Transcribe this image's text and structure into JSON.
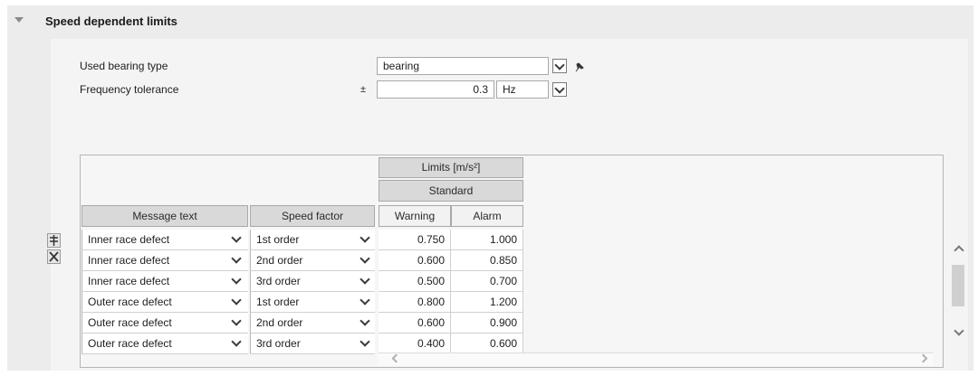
{
  "section": {
    "title": "Speed dependent limits"
  },
  "form": {
    "bearing_type_label": "Used bearing type",
    "bearing_type_value": "bearing",
    "tolerance_label": "Frequency tolerance",
    "tolerance_prefix": "±",
    "tolerance_value": "0.3",
    "tolerance_unit": "Hz"
  },
  "table": {
    "group_header": "Limits [m/s²]",
    "subgroup_header": "Standard",
    "columns": [
      "Message text",
      "Speed factor",
      "Warning",
      "Alarm"
    ],
    "rows": [
      {
        "message": "Inner race defect",
        "factor": "1st order",
        "warning": "0.750",
        "alarm": "1.000"
      },
      {
        "message": "Inner race defect",
        "factor": "2nd order",
        "warning": "0.600",
        "alarm": "0.850"
      },
      {
        "message": "Inner race defect",
        "factor": "3rd order",
        "warning": "0.500",
        "alarm": "0.700"
      },
      {
        "message": "Outer race defect",
        "factor": "1st order",
        "warning": "0.800",
        "alarm": "1.200"
      },
      {
        "message": "Outer race defect",
        "factor": "2nd order",
        "warning": "0.600",
        "alarm": "0.900"
      },
      {
        "message": "Outer race defect",
        "factor": "3rd order",
        "warning": "0.400",
        "alarm": "0.600"
      }
    ]
  },
  "icons": {
    "collapse": "triangle-down-icon",
    "pin": "pin-icon",
    "add_row": "add-row-icon",
    "delete_row": "delete-row-icon"
  }
}
